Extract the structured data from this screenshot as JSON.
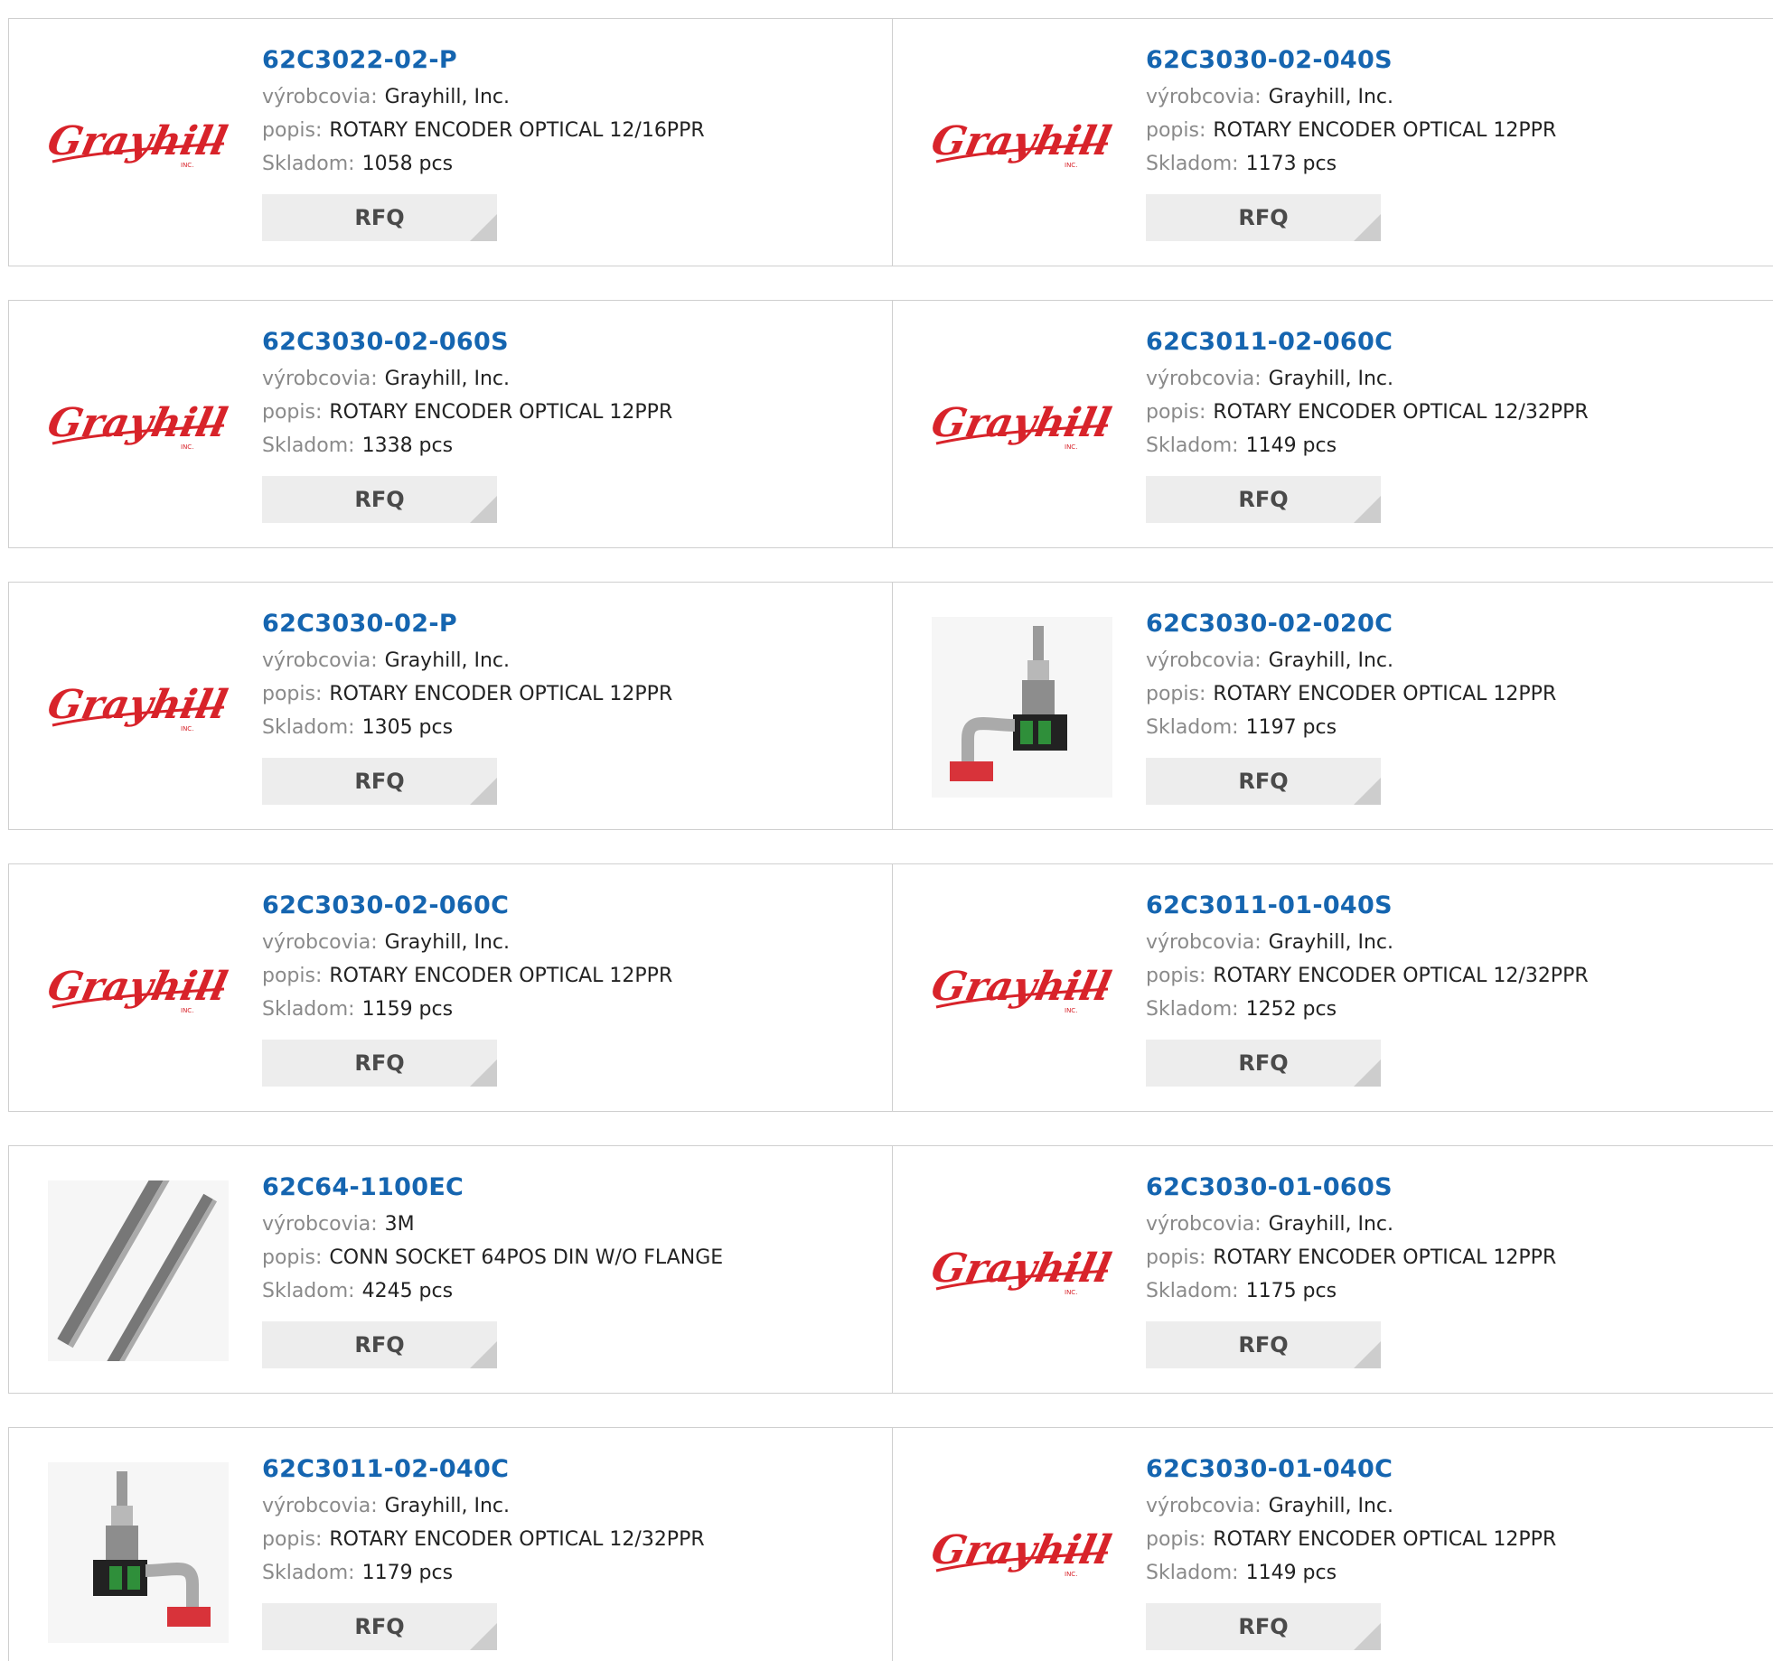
{
  "labels": {
    "manufacturer": "výrobcovia:",
    "description": "popis:",
    "stock": "Skladom:",
    "rfq": "RFQ"
  },
  "logo_text": "Grayhill",
  "logo_subtext": "INC.",
  "colors": {
    "part_link": "#1565b0",
    "logo_red": "#d8232a",
    "label_gray": "#8a8a8a",
    "rfq_bg": "#ededed"
  },
  "products": [
    {
      "part": "62C3022-02-P",
      "manufacturer": "Grayhill, Inc.",
      "description": "ROTARY ENCODER OPTICAL 12/16PPR",
      "stock": "1058 pcs",
      "image": "grayhill-logo"
    },
    {
      "part": "62C3030-02-040S",
      "manufacturer": "Grayhill, Inc.",
      "description": "ROTARY ENCODER OPTICAL 12PPR",
      "stock": "1173 pcs",
      "image": "grayhill-logo"
    },
    {
      "part": "62C3030-02-060S",
      "manufacturer": "Grayhill, Inc.",
      "description": "ROTARY ENCODER OPTICAL 12PPR",
      "stock": "1338 pcs",
      "image": "grayhill-logo"
    },
    {
      "part": "62C3011-02-060C",
      "manufacturer": "Grayhill, Inc.",
      "description": "ROTARY ENCODER OPTICAL 12/32PPR",
      "stock": "1149 pcs",
      "image": "grayhill-logo"
    },
    {
      "part": "62C3030-02-P",
      "manufacturer": "Grayhill, Inc.",
      "description": "ROTARY ENCODER OPTICAL 12PPR",
      "stock": "1305 pcs",
      "image": "grayhill-logo"
    },
    {
      "part": "62C3030-02-020C",
      "manufacturer": "Grayhill, Inc.",
      "description": "ROTARY ENCODER OPTICAL 12PPR",
      "stock": "1197 pcs",
      "image": "encoder-photo"
    },
    {
      "part": "62C3030-02-060C",
      "manufacturer": "Grayhill, Inc.",
      "description": "ROTARY ENCODER OPTICAL 12PPR",
      "stock": "1159 pcs",
      "image": "grayhill-logo"
    },
    {
      "part": "62C3011-01-040S",
      "manufacturer": "Grayhill, Inc.",
      "description": "ROTARY ENCODER OPTICAL 12/32PPR",
      "stock": "1252 pcs",
      "image": "grayhill-logo"
    },
    {
      "part": "62C64-1100EC",
      "manufacturer": "3M",
      "description": "CONN SOCKET 64POS DIN W/O FLANGE",
      "stock": "4245 pcs",
      "image": "din-socket-photo"
    },
    {
      "part": "62C3030-01-060S",
      "manufacturer": "Grayhill, Inc.",
      "description": "ROTARY ENCODER OPTICAL 12PPR",
      "stock": "1175 pcs",
      "image": "grayhill-logo"
    },
    {
      "part": "62C3011-02-040C",
      "manufacturer": "Grayhill, Inc.",
      "description": "ROTARY ENCODER OPTICAL 12/32PPR",
      "stock": "1179 pcs",
      "image": "encoder-photo-2"
    },
    {
      "part": "62C3030-01-040C",
      "manufacturer": "Grayhill, Inc.",
      "description": "ROTARY ENCODER OPTICAL 12PPR",
      "stock": "1149 pcs",
      "image": "grayhill-logo"
    }
  ]
}
